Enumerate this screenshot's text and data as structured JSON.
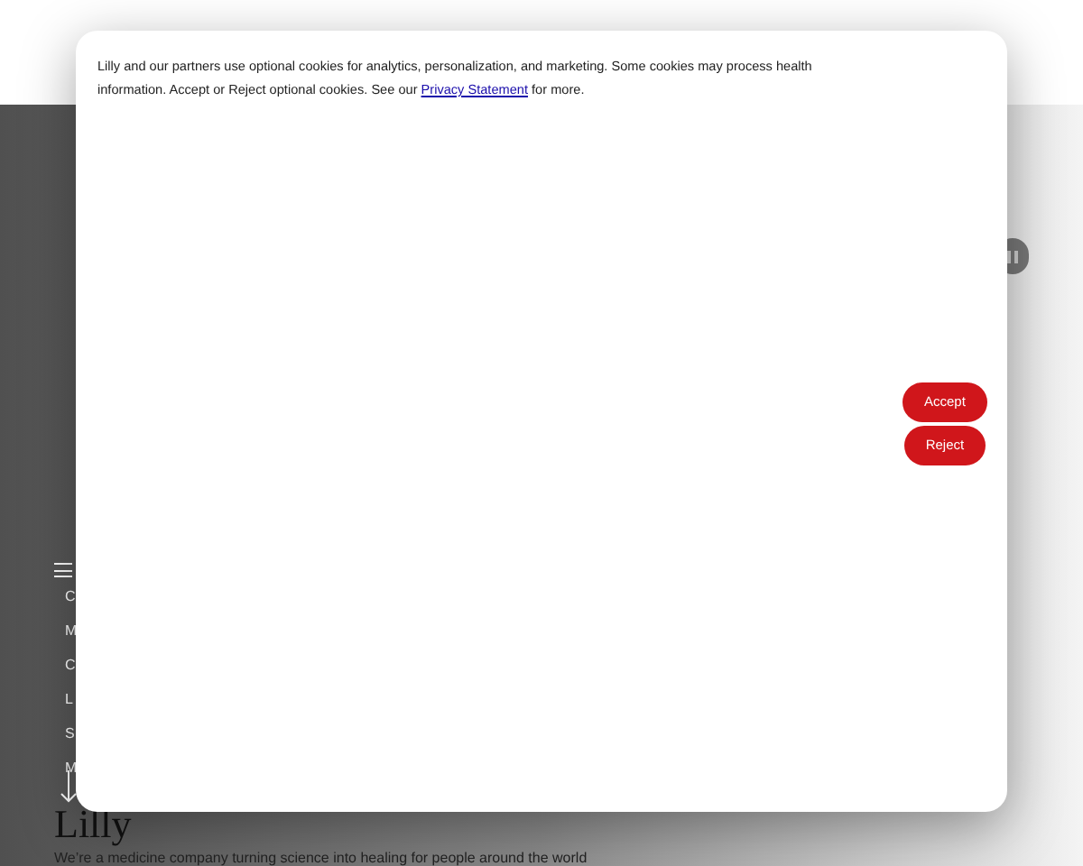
{
  "background_page": {
    "nav_items": [
      "C",
      "M",
      "C",
      "L",
      "S",
      "M"
    ],
    "heading": "Lilly",
    "tagline": "We’re a medicine company turning science into healing for people around the world"
  },
  "cookie_dialog": {
    "message_before_link": "Lilly and our partners use optional cookies for analytics, personalization, and marketing. Some cookies may process health information. Accept or Reject optional cookies. See our ",
    "link": "Privacy Statement",
    "message_after_link": " for more.",
    "buttons": [
      "Accept",
      "Reject"
    ]
  }
}
